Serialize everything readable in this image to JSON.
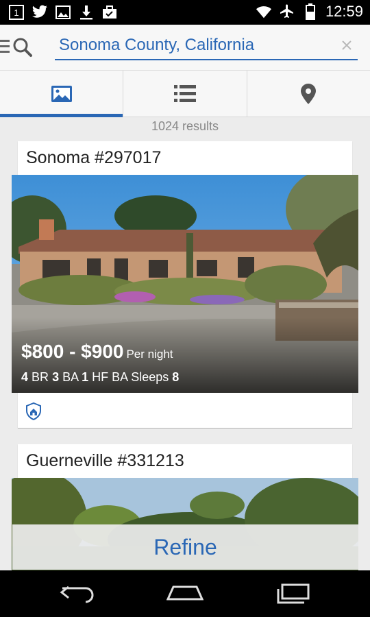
{
  "status_bar": {
    "time": "12:59",
    "notification_badge": "1",
    "left_icons": [
      "notification-count-icon",
      "twitter-icon",
      "image-icon",
      "download-icon",
      "briefcase-icon"
    ],
    "right_icons": [
      "wifi-icon",
      "airplane-mode-icon",
      "battery-icon"
    ]
  },
  "search": {
    "value": "Sonoma County, California"
  },
  "tabs": [
    {
      "name": "photos",
      "icon": "photo-icon",
      "active": true
    },
    {
      "name": "list",
      "icon": "list-icon",
      "active": false
    },
    {
      "name": "map",
      "icon": "map-pin-icon",
      "active": false
    }
  ],
  "results_label": "1024 results",
  "listings": [
    {
      "title": "Sonoma #297017",
      "price": "$800 - $900",
      "price_unit": "Per night",
      "br": "4",
      "br_label": "BR",
      "ba": "3",
      "ba_label": "BA",
      "hf": "1",
      "hf_label": "HF BA",
      "sleeps_label": "Sleeps",
      "sleeps": "8",
      "badge_icon": "verified-shield-icon"
    },
    {
      "title": "Guerneville #331213"
    }
  ],
  "refine_label": "Refine",
  "colors": {
    "accent": "#2a67b5",
    "background": "#ececec",
    "card": "#ffffff",
    "status_bar": "#000000"
  }
}
